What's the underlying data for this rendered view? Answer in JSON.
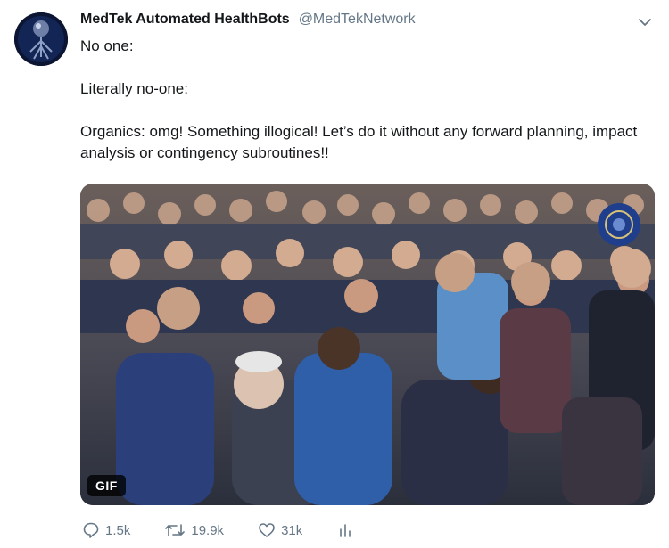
{
  "tweet": {
    "display_name": "MedTek Automated HealthBots",
    "handle": "@MedTekNetwork",
    "lines": [
      "No one:",
      "Literally no-one:",
      "Organics: omg! Something illogical! Let’s do it without any forward planning, impact analysis or contingency subroutines!!"
    ],
    "media": {
      "badge": "GIF"
    },
    "stats": {
      "replies": "1.5k",
      "retweets": "19.9k",
      "likes": "31k"
    }
  },
  "icons": [
    "avatar-logo-icon",
    "chevron-down-icon",
    "reply-icon",
    "retweet-icon",
    "like-icon",
    "analytics-icon"
  ],
  "colors": {
    "text": "#14171a",
    "secondary": "#657786",
    "link_blue": "#1da1f2"
  }
}
